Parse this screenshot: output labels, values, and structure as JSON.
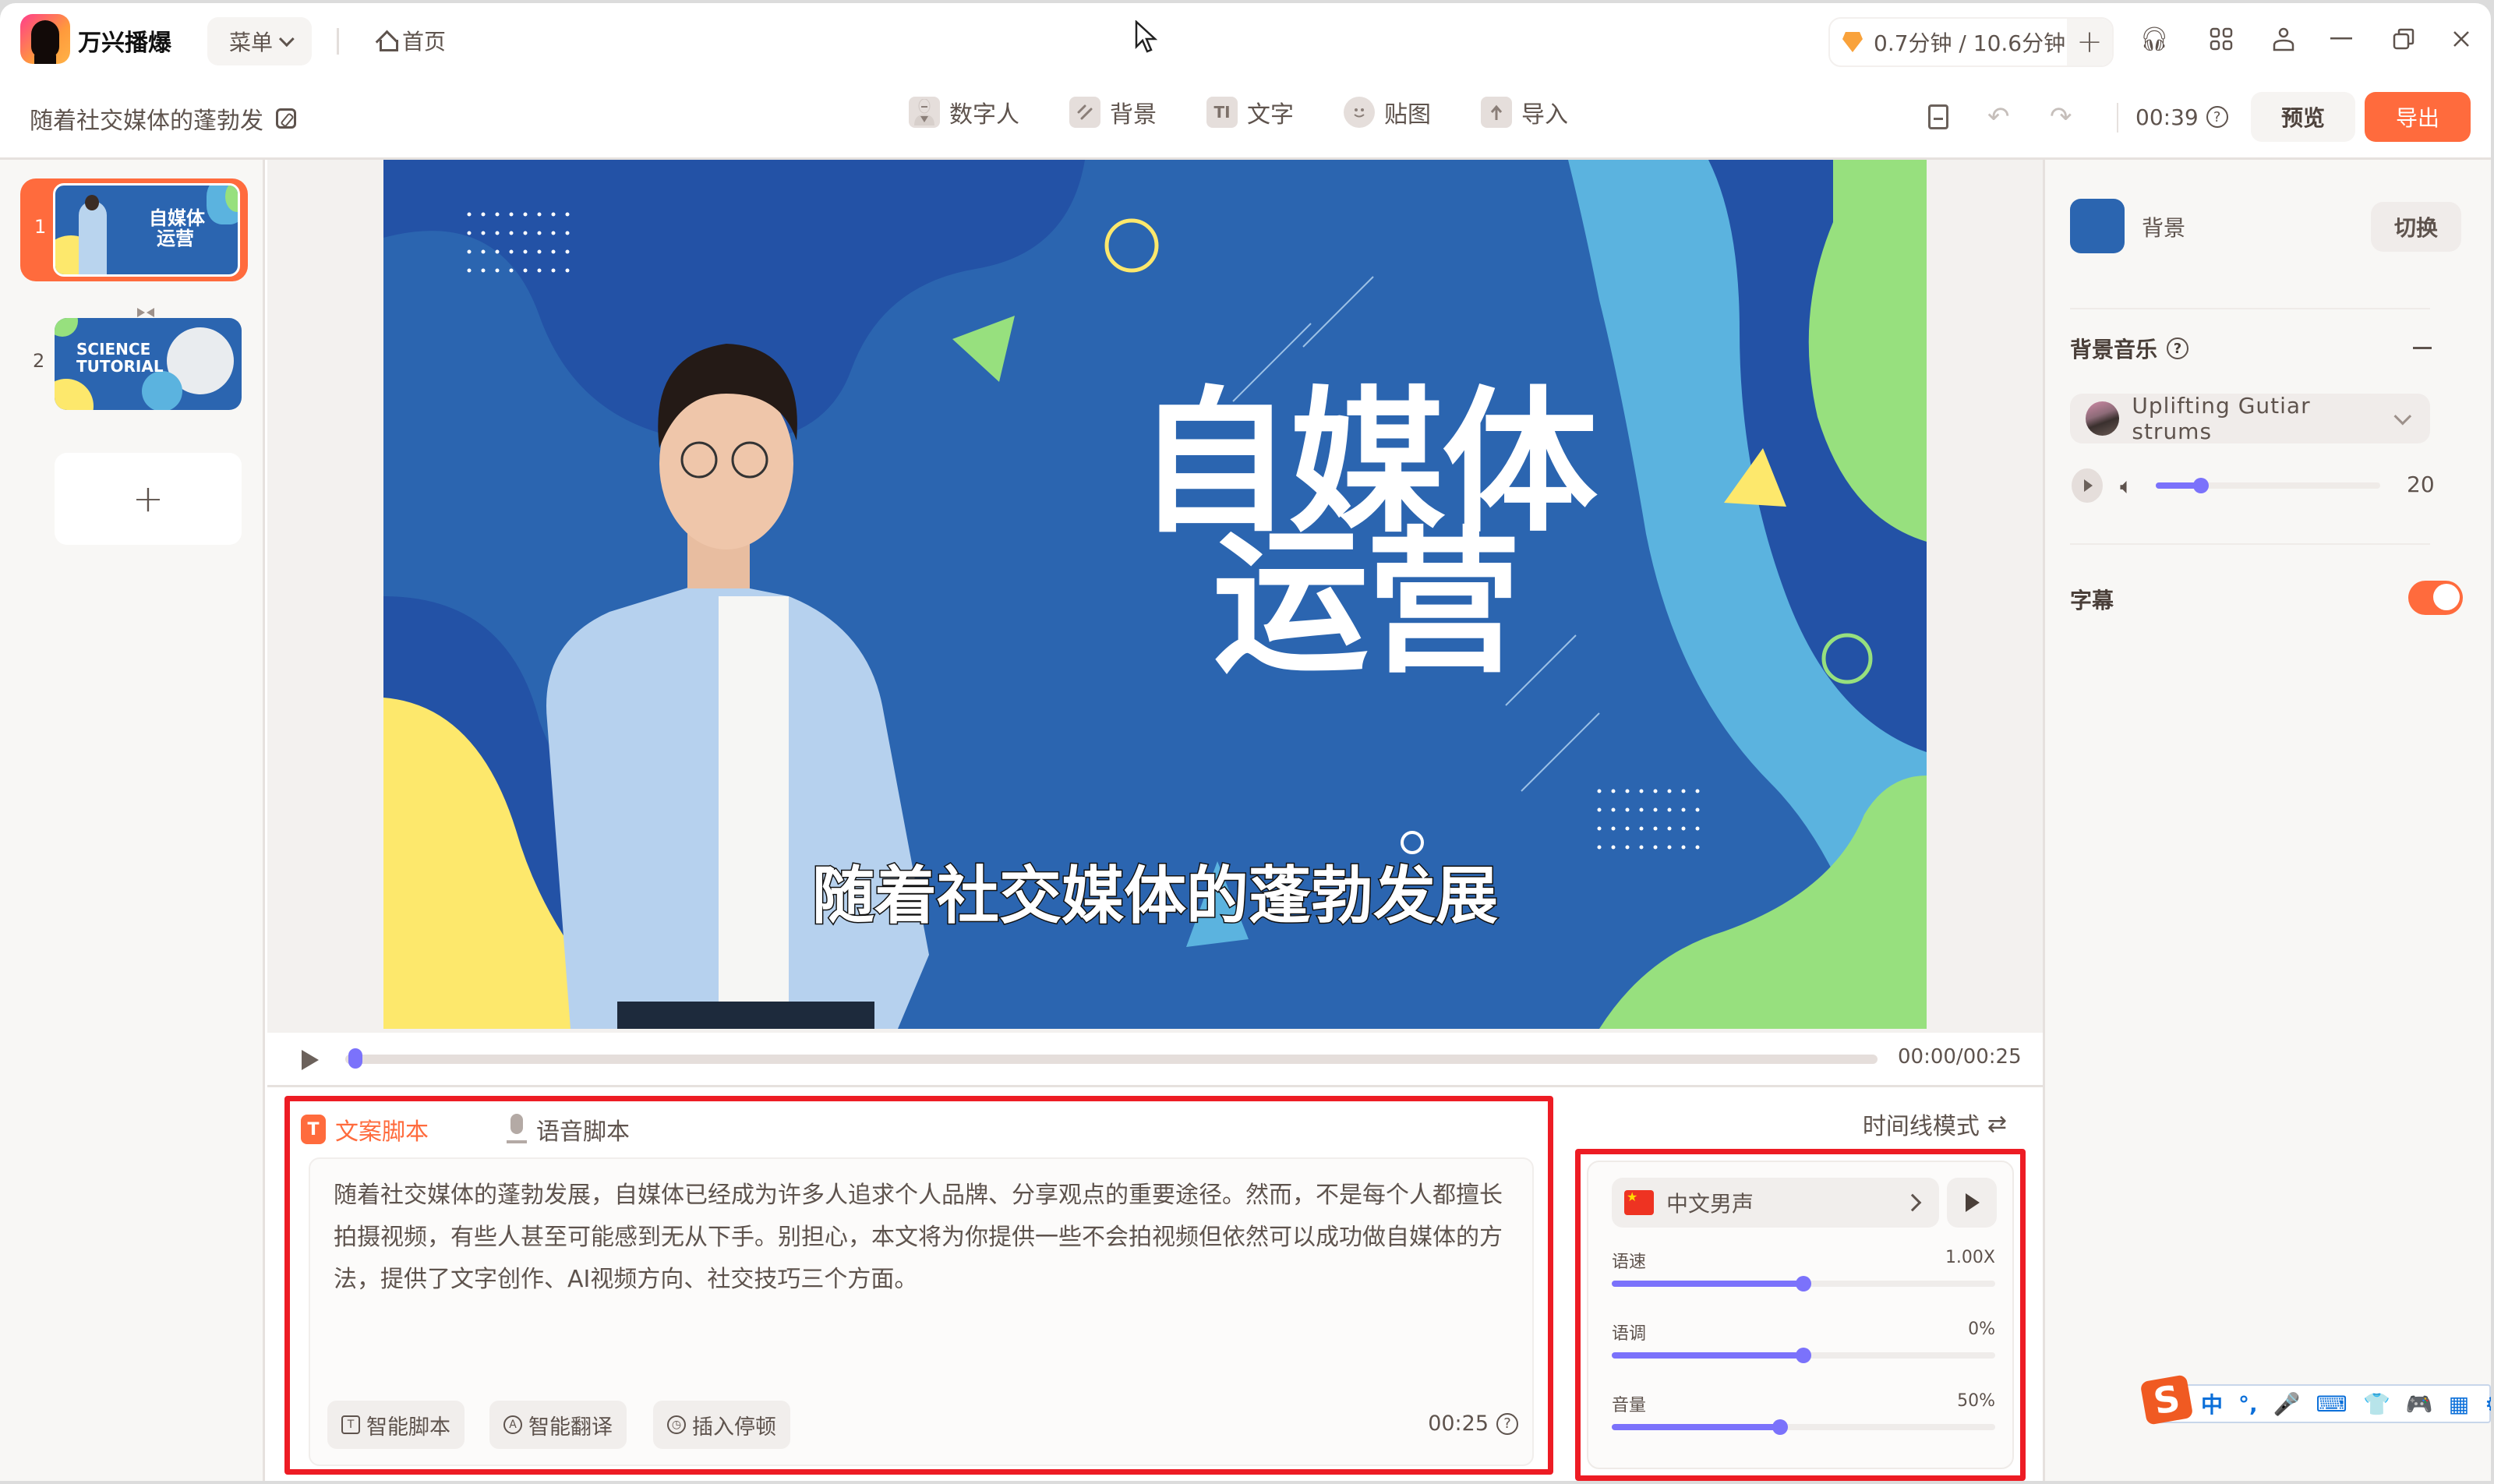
{
  "app": {
    "name": "万兴播爆",
    "menu_label": "菜单",
    "home_label": "首页",
    "quota_text": "0.7分钟 / 10.6分钟",
    "quota_plus": "+",
    "window_icons": [
      "headset-icon",
      "apps-grid-icon",
      "user-icon",
      "minimize-icon",
      "restore-icon",
      "close-icon"
    ]
  },
  "toolbar": {
    "project_title": "随着社交媒体的蓬勃发",
    "tools": [
      {
        "label": "数字人",
        "icon": "digital-human-icon",
        "glyph": "👤"
      },
      {
        "label": "背景",
        "icon": "background-icon",
        "glyph": "//"
      },
      {
        "label": "文字",
        "icon": "text-icon",
        "glyph": "TI"
      },
      {
        "label": "贴图",
        "icon": "sticker-icon",
        "glyph": "☺"
      },
      {
        "label": "导入",
        "icon": "import-icon",
        "glyph": "↑"
      }
    ],
    "duration": "00:39",
    "preview_label": "预览",
    "export_label": "导出"
  },
  "slides": [
    {
      "number": "1",
      "title_line1": "自媒体",
      "title_line2": "运营",
      "selected": true
    },
    {
      "number": "2",
      "title_line1": "SCIENCE",
      "title_line2": "TUTORIAL",
      "selected": false
    }
  ],
  "canvas": {
    "title_line1": "自媒体",
    "title_line2": "运营",
    "subtitle": "随着社交媒体的蓬勃发展",
    "colors": {
      "base": "#2b65b0",
      "dark": "#2352a6",
      "light": "#5bb3df",
      "green": "#97e07e",
      "yellow": "#fde86c"
    }
  },
  "player": {
    "time": "00:00/00:25",
    "progress": 0
  },
  "script": {
    "tabs": [
      {
        "label": "文案脚本",
        "active": true
      },
      {
        "label": "语音脚本",
        "active": false
      }
    ],
    "text": "随着社交媒体的蓬勃发展，自媒体已经成为许多人追求个人品牌、分享观点的重要途径。然而，不是每个人都擅长拍摄视频，有些人甚至可能感到无从下手。别担心，本文将为你提供一些不会拍视频但依然可以成功做自媒体的方法，提供了文字创作、AI视频方向、社交技巧三个方面。",
    "actions": [
      "智能脚本",
      "智能翻译",
      "插入停顿"
    ],
    "duration": "00:25"
  },
  "voice": {
    "timeline_mode_label": "时间线模式",
    "voice_name": "中文男声",
    "sliders": [
      {
        "label": "语速",
        "value_text": "1.00X",
        "fraction": 0.5
      },
      {
        "label": "语调",
        "value_text": "0%",
        "fraction": 0.5
      },
      {
        "label": "音量",
        "value_text": "50%",
        "fraction": 0.44
      }
    ]
  },
  "right_panel": {
    "background_label": "背景",
    "switch_label": "切换",
    "music_title": "背景音乐",
    "music_track": "Uplifting Gutiar strums",
    "music_volume": "20",
    "music_volume_fraction": 0.2,
    "subtitle_label": "字幕",
    "subtitle_enabled": true
  },
  "ime": {
    "items": [
      "中",
      "°,",
      "🎤",
      "⌨",
      "👕",
      "🎮",
      "▦",
      "⚙"
    ]
  }
}
